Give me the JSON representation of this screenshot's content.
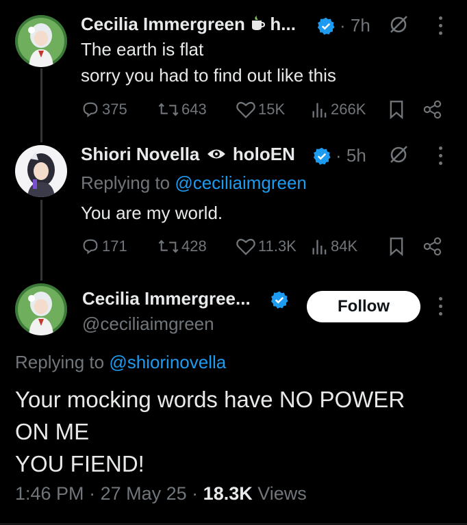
{
  "tweet1": {
    "author_name": "Cecilia Immergreen",
    "name_suffix": "h...",
    "time": "· 7h",
    "lines": [
      "The earth is flat",
      "sorry you had to find out like this"
    ],
    "stats": {
      "replies": "375",
      "reposts": "643",
      "likes": "15K",
      "views": "266K"
    }
  },
  "tweet2": {
    "author_name": "Shiori Novella",
    "name_suffix": "holoEN",
    "time": "· 5h",
    "replying_prefix": "Replying to ",
    "replying_handle": "@ceciliaimgreen",
    "lines": [
      "You are my world."
    ],
    "stats": {
      "replies": "171",
      "reposts": "428",
      "likes": "11.3K",
      "views": "84K"
    }
  },
  "main": {
    "author_name": "Cecilia Immergree...",
    "handle": "@ceciliaimgreen",
    "follow_label": "Follow",
    "replying_prefix": "Replying to ",
    "replying_handle": "@shiorinovella",
    "lines": [
      "Your mocking words have NO POWER",
      "ON ME",
      "YOU FIEND!"
    ],
    "time": "1:46 PM",
    "date": "27 May 25",
    "views_count": "18.3K",
    "views_label": "Views"
  },
  "colors": {
    "accent": "#1d9bf0",
    "muted": "#71767b",
    "text": "#e7e9ea",
    "background": "#000000"
  }
}
